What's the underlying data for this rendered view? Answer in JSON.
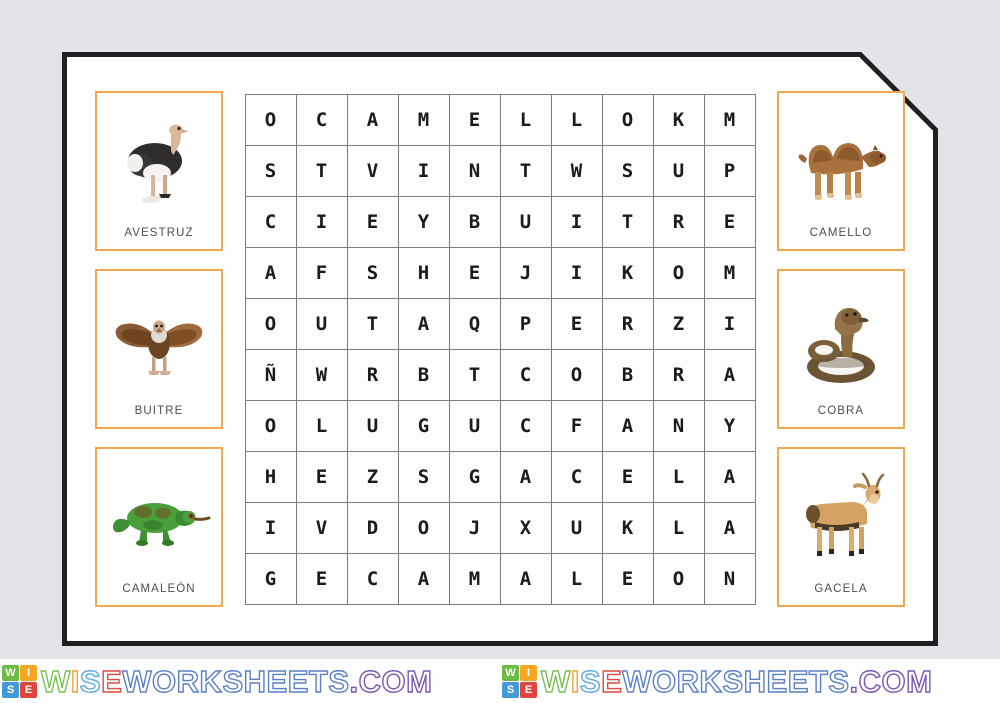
{
  "page": {
    "background_color": "#e2e4e9",
    "sheet_color": "#ffffff",
    "border_color": "#231f20",
    "card_border_color": "#f0a94e",
    "grid_line_color": "#7c7c7c"
  },
  "left_cards": [
    {
      "label": "AVESTRUZ",
      "icon": "ostrich-photo"
    },
    {
      "label": "BUITRE",
      "icon": "vulture-photo"
    },
    {
      "label": "CAMALEÓN",
      "icon": "chameleon-photo"
    }
  ],
  "right_cards": [
    {
      "label": "CAMELLO",
      "icon": "camel-photo"
    },
    {
      "label": "COBRA",
      "icon": "cobra-photo"
    },
    {
      "label": "GACELA",
      "icon": "gazelle-photo"
    }
  ],
  "word_search": {
    "columns": 10,
    "rows": 10,
    "grid": [
      [
        "O",
        "C",
        "A",
        "M",
        "E",
        "L",
        "L",
        "O",
        "K",
        "M"
      ],
      [
        "S",
        "T",
        "V",
        "I",
        "N",
        "T",
        "W",
        "S",
        "U",
        "P"
      ],
      [
        "C",
        "I",
        "E",
        "Y",
        "B",
        "U",
        "I",
        "T",
        "R",
        "E"
      ],
      [
        "A",
        "F",
        "S",
        "H",
        "E",
        "J",
        "I",
        "K",
        "O",
        "M"
      ],
      [
        "O",
        "U",
        "T",
        "A",
        "Q",
        "P",
        "E",
        "R",
        "Z",
        "I"
      ],
      [
        "Ñ",
        "W",
        "R",
        "B",
        "T",
        "C",
        "O",
        "B",
        "R",
        "A"
      ],
      [
        "O",
        "L",
        "U",
        "G",
        "U",
        "C",
        "F",
        "A",
        "N",
        "Y"
      ],
      [
        "H",
        "E",
        "Z",
        "S",
        "G",
        "A",
        "C",
        "E",
        "L",
        "A"
      ],
      [
        "I",
        "V",
        "D",
        "O",
        "J",
        "X",
        "U",
        "K",
        "L",
        "A"
      ],
      [
        "G",
        "E",
        "C",
        "A",
        "M",
        "A",
        "L",
        "E",
        "O",
        "N"
      ]
    ]
  },
  "watermark": {
    "text": "WISEWORKSHEETS.COM",
    "logo_tiles": [
      {
        "letter": "W",
        "color": "#6cbb45"
      },
      {
        "letter": "I",
        "color": "#f5a623"
      },
      {
        "letter": "S",
        "color": "#3f9ad6"
      },
      {
        "letter": "E",
        "color": "#e0443d"
      }
    ],
    "letter_colors": [
      "#7bbf54",
      "#f0a33c",
      "#5ea9dd",
      "#dd4b42",
      "#5a7fc7",
      "#5a7fc7",
      "#5a7fc7",
      "#5a7fc7",
      "#5a7fc7",
      "#5a7fc7",
      "#5a7fc7",
      "#5a7fc7",
      "#5a7fc7",
      "#5a7fc7",
      "#7a56b5",
      "#7a56b5",
      "#7a56b5",
      "#7a56b5"
    ]
  }
}
